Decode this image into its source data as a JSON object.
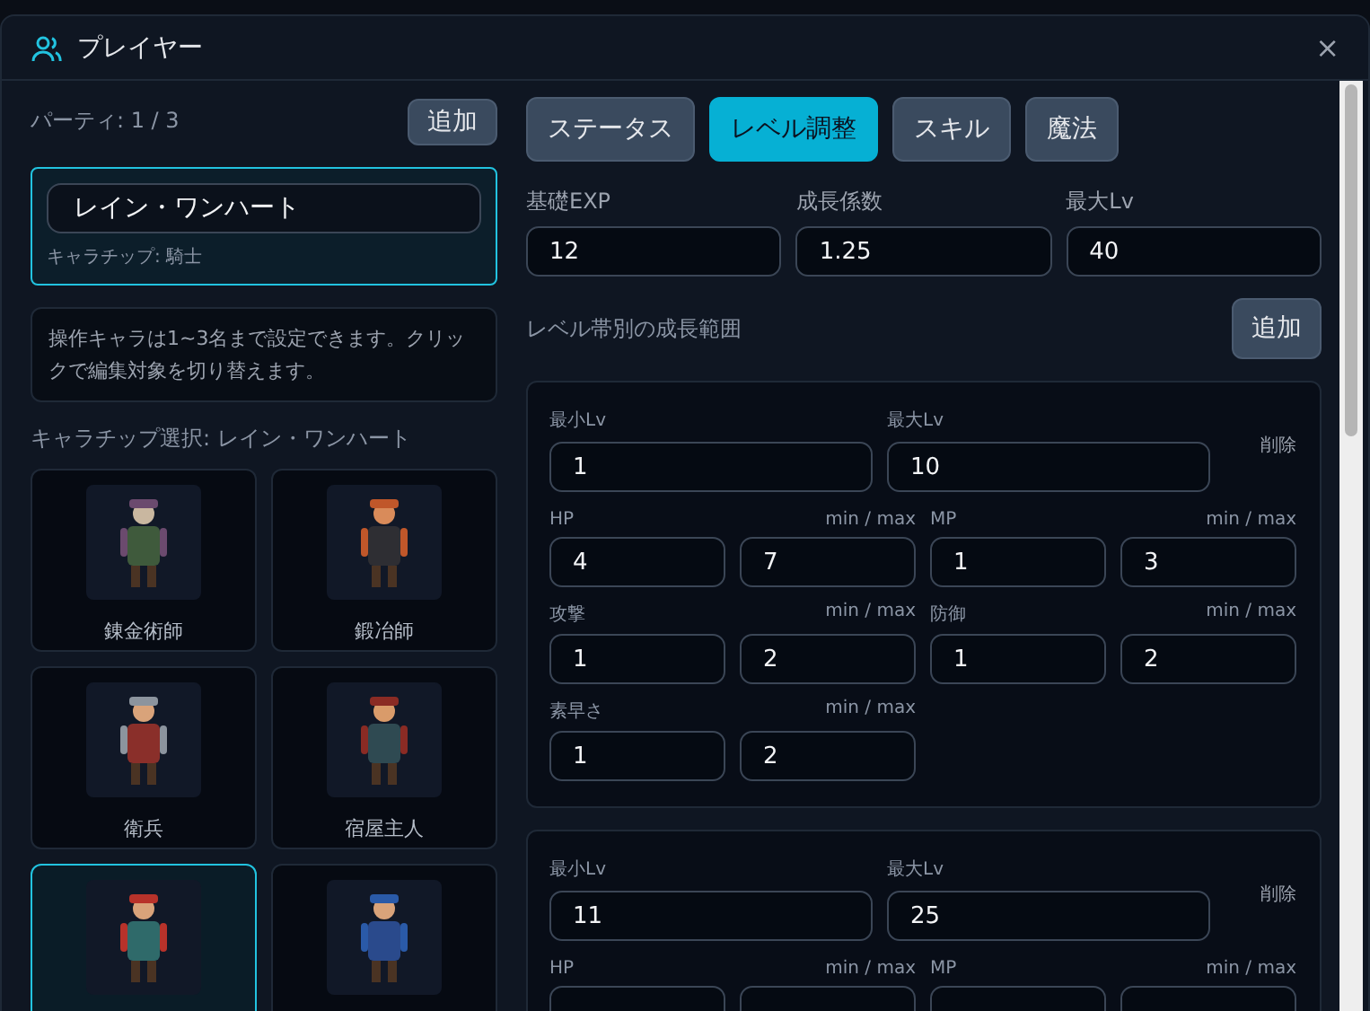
{
  "window": {
    "title": "プレイヤー",
    "close": "×"
  },
  "party": {
    "label": "パーティ: 1 / 3",
    "add_button": "追加",
    "members": [
      {
        "name": "レイン・ワンハート",
        "chip": "キャラチップ: 騎士",
        "selected": true
      }
    ]
  },
  "info": "操作キャラは1~3名まで設定できます。クリックで編集対象を切り替えます。",
  "chip_select": {
    "label": "キャラチップ選択: レイン・ワンハート",
    "items": [
      {
        "name": "錬金術師",
        "selected": false
      },
      {
        "name": "鍛冶師",
        "selected": false
      },
      {
        "name": "衛兵",
        "selected": false
      },
      {
        "name": "宿屋主人",
        "selected": false
      },
      {
        "selected": true
      },
      {
        "selected": false
      }
    ]
  },
  "tabs": [
    {
      "label": "ステータス",
      "selected": false
    },
    {
      "label": "レベル調整",
      "selected": true
    },
    {
      "label": "スキル",
      "selected": false
    },
    {
      "label": "魔法",
      "selected": false
    }
  ],
  "growth": {
    "fields": [
      {
        "label": "基礎EXP",
        "value": "12"
      },
      {
        "label": "成長係数",
        "value": "1.25"
      },
      {
        "label": "最大Lv",
        "value": "40"
      }
    ],
    "bands_label": "レベル帯別の成長範囲",
    "add_button": "追加",
    "bands": [
      {
        "min_label": "最小Lv",
        "min": "1",
        "max_label": "最大Lv",
        "max": "10",
        "delete": "削除",
        "stats": [
          {
            "label": "HP",
            "hint": "min / max",
            "min": "4",
            "max": "7"
          },
          {
            "label": "MP",
            "hint": "min / max",
            "min": "1",
            "max": "3"
          },
          {
            "label": "攻撃",
            "hint": "min / max",
            "min": "1",
            "max": "2"
          },
          {
            "label": "防御",
            "hint": "min / max",
            "min": "1",
            "max": "2"
          },
          {
            "label": "素早さ",
            "hint": "min / max",
            "min": "1",
            "max": "2"
          }
        ]
      },
      {
        "min_label": "最小Lv",
        "min": "11",
        "max_label": "最大Lv",
        "max": "25",
        "delete": "削除",
        "stats": [
          {
            "label": "HP",
            "hint": "min / max"
          },
          {
            "label": "MP",
            "hint": "min / max"
          }
        ]
      }
    ]
  }
}
